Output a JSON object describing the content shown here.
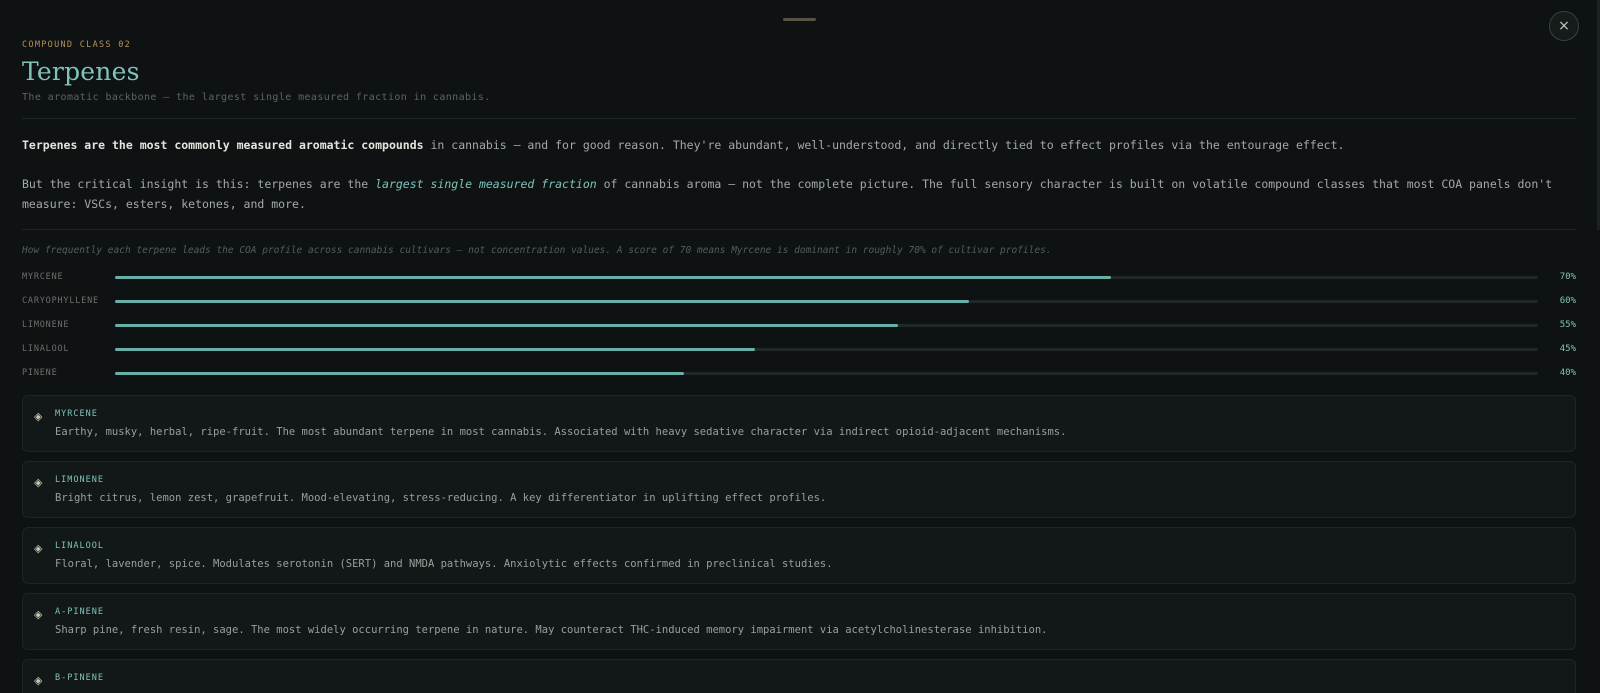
{
  "header": {
    "eyebrow": "COMPOUND CLASS 02",
    "title": "Terpenes",
    "subtitle": "The aromatic backbone — the largest single measured fraction in cannabis.",
    "close_label": "×"
  },
  "intro": {
    "p1_bold": "Terpenes are the most commonly measured aromatic compounds",
    "p1_rest": " in cannabis — and for good reason. They're abundant, well-understood, and directly tied to effect profiles via the entourage effect.",
    "p2_start": "But the critical insight is this: terpenes are the ",
    "p2_em": "largest single measured fraction",
    "p2_end": " of cannabis aroma — not the complete picture. The full sensory character is built on volatile compound classes that most COA panels don't measure: VSCs, esters, ketones, and more."
  },
  "chart_data": {
    "type": "bar",
    "caption": "How frequently each terpene leads the COA profile across cannabis cultivars — not concentration values. A score of 70 means Myrcene is dominant in roughly 70% of cultivar profiles.",
    "categories": [
      "MYRCENE",
      "CARYOPHYLLENE",
      "LIMONENE",
      "LINALOOL",
      "PINENE"
    ],
    "values": [
      70,
      60,
      55,
      45,
      40
    ],
    "value_labels": [
      "70%",
      "60%",
      "55%",
      "45%",
      "40%"
    ],
    "ylim": [
      0,
      100
    ],
    "orientation": "horizontal",
    "bar_color": "#67b1a8"
  },
  "cards": [
    {
      "icon": "diamond-icon",
      "name": "MYRCENE",
      "desc": "Earthy, musky, herbal, ripe-fruit. The most abundant terpene in most cannabis. Associated with heavy sedative character via indirect opioid-adjacent mechanisms."
    },
    {
      "icon": "diamond-icon",
      "name": "LIMONENE",
      "desc": "Bright citrus, lemon zest, grapefruit. Mood-elevating, stress-reducing. A key differentiator in uplifting effect profiles."
    },
    {
      "icon": "diamond-icon",
      "name": "LINALOOL",
      "desc": "Floral, lavender, spice. Modulates serotonin (SERT) and NMDA pathways. Anxiolytic effects confirmed in preclinical studies."
    },
    {
      "icon": "diamond-icon",
      "name": "A-PINENE",
      "desc": "Sharp pine, fresh resin, sage. The most widely occurring terpene in nature. May counteract THC-induced memory impairment via acetylcholinesterase inhibition."
    },
    {
      "icon": "diamond-icon",
      "name": "B-PINENE",
      "desc": ""
    }
  ],
  "colors": {
    "accent": "#7fc3bb",
    "eyebrow": "#b4935a",
    "background": "#0e1213"
  }
}
